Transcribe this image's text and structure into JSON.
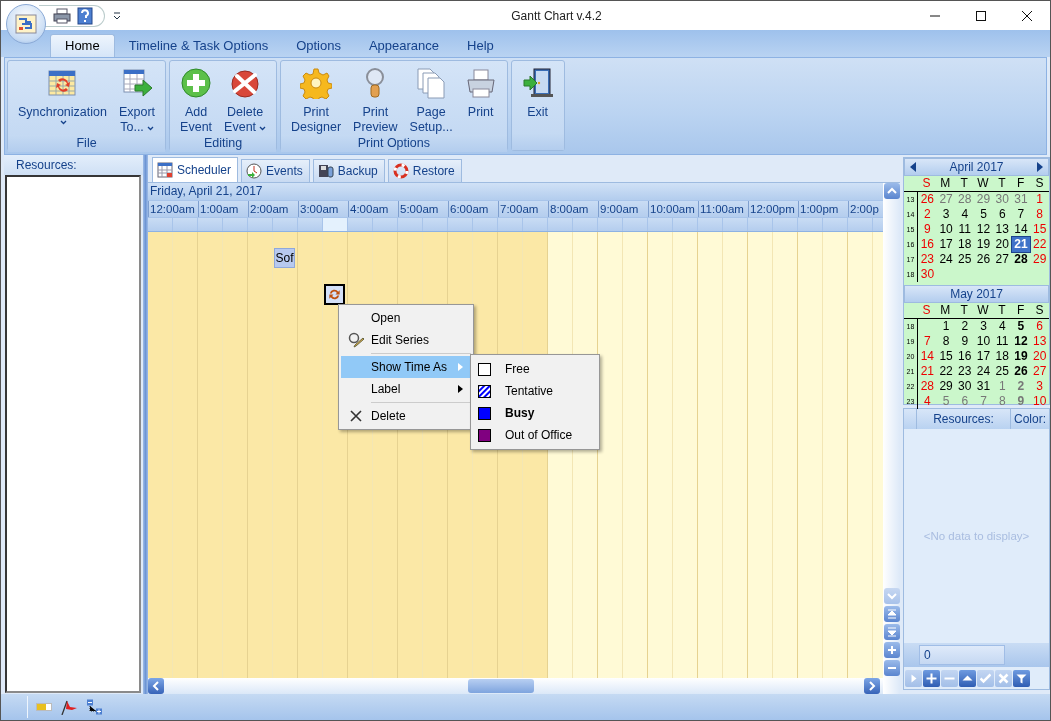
{
  "window": {
    "title": "Gantt Chart v.4.2"
  },
  "ribbon_tabs": [
    {
      "label": "Home",
      "selected": true
    },
    {
      "label": "Timeline & Task Options",
      "selected": false
    },
    {
      "label": "Options",
      "selected": false
    },
    {
      "label": "Appearance",
      "selected": false
    },
    {
      "label": "Help",
      "selected": false
    }
  ],
  "ribbon_groups": [
    {
      "label": "File",
      "buttons": [
        {
          "lines": [
            "Synchronization"
          ],
          "dropdown": true
        },
        {
          "lines": [
            "Export",
            "To..."
          ],
          "dropdown": true
        }
      ]
    },
    {
      "label": "Editing",
      "buttons": [
        {
          "lines": [
            "Add",
            "Event"
          ],
          "dropdown": false
        },
        {
          "lines": [
            "Delete",
            "Event"
          ],
          "dropdown": true
        }
      ]
    },
    {
      "label": "Print Options",
      "buttons": [
        {
          "lines": [
            "Print",
            "Designer"
          ],
          "dropdown": false
        },
        {
          "lines": [
            "Print",
            "Preview"
          ],
          "dropdown": false
        },
        {
          "lines": [
            "Page",
            "Setup..."
          ],
          "dropdown": false
        },
        {
          "lines": [
            "Print"
          ],
          "dropdown": false
        }
      ]
    },
    {
      "buttons": [
        {
          "lines": [
            "Exit"
          ],
          "dropdown": false
        }
      ]
    }
  ],
  "left_panel": {
    "header": "Resources:"
  },
  "view_tabs": [
    {
      "label": "Scheduler",
      "selected": true
    },
    {
      "label": "Events",
      "selected": false
    },
    {
      "label": "Backup",
      "selected": false
    },
    {
      "label": "Restore",
      "selected": false
    }
  ],
  "scheduler": {
    "date": "Friday, April 21, 2017",
    "time_slots": [
      {
        "label": "12:00am",
        "work": false,
        "marked": false
      },
      {
        "label": "1:00am",
        "work": false,
        "marked": false
      },
      {
        "label": "2:00am",
        "work": false,
        "marked": false
      },
      {
        "label": "3:00am",
        "work": false,
        "marked": true
      },
      {
        "label": "4:00am",
        "work": false,
        "marked": false
      },
      {
        "label": "5:00am",
        "work": false,
        "marked": false
      },
      {
        "label": "6:00am",
        "work": false,
        "marked": false
      },
      {
        "label": "7:00am",
        "work": false,
        "marked": false
      },
      {
        "label": "8:00am",
        "work": true,
        "marked": false
      },
      {
        "label": "9:00am",
        "work": true,
        "marked": false
      },
      {
        "label": "10:00am",
        "work": true,
        "marked": false
      },
      {
        "label": "11:00am",
        "work": true,
        "marked": false
      },
      {
        "label": "12:00pm",
        "work": true,
        "marked": false
      },
      {
        "label": "1:00pm",
        "work": true,
        "marked": false
      },
      {
        "label": "2:00p",
        "work": true,
        "marked": false
      }
    ],
    "appointments": [
      {
        "label": "Sof",
        "selected": false,
        "recurring": false
      },
      {
        "selected": true,
        "recurring": true
      }
    ]
  },
  "context_menu": [
    {
      "kind": "item",
      "label": "Open",
      "selected": false
    },
    {
      "kind": "item",
      "label": "Edit Series",
      "selected": false
    },
    {
      "kind": "separator"
    },
    {
      "kind": "submenu",
      "label": "Show Time As",
      "selected": true
    },
    {
      "kind": "submenu",
      "label": "Label",
      "selected": false
    },
    {
      "kind": "separator"
    },
    {
      "kind": "item",
      "label": "Delete",
      "selected": false
    }
  ],
  "submenu": [
    {
      "label": "Free",
      "color": "#ffffff",
      "kind": "solid",
      "selected": false
    },
    {
      "label": "Tentative",
      "color": "#0000ff",
      "kind": "hatched",
      "selected": false
    },
    {
      "label": "Busy",
      "color": "#0000ff",
      "kind": "solid",
      "selected": true
    },
    {
      "label": "Out of Office",
      "color": "#800080",
      "kind": "solid",
      "selected": false
    }
  ],
  "calendars": [
    {
      "title": "April 2017",
      "prev": true,
      "next": true,
      "weekdays": [
        "S",
        "M",
        "T",
        "W",
        "T",
        "F",
        "S"
      ],
      "weeks": [
        {
          "number": "13",
          "skip_first": false,
          "days": [
            {
              "d": "26",
              "muted": false,
              "bold": false,
              "selected": false
            },
            {
              "d": "27",
              "muted": true,
              "bold": false,
              "selected": false
            },
            {
              "d": "28",
              "muted": true,
              "bold": false,
              "selected": false
            },
            {
              "d": "29",
              "muted": true,
              "bold": false,
              "selected": false
            },
            {
              "d": "30",
              "muted": true,
              "bold": false,
              "selected": false
            },
            {
              "d": "31",
              "muted": true,
              "bold": false,
              "selected": false
            },
            {
              "d": "1",
              "muted": false,
              "bold": false,
              "selected": false
            }
          ]
        },
        {
          "number": "14",
          "skip_first": false,
          "days": [
            {
              "d": "2",
              "muted": false,
              "bold": false,
              "selected": false
            },
            {
              "d": "3",
              "muted": false,
              "bold": false,
              "selected": false
            },
            {
              "d": "4",
              "muted": false,
              "bold": false,
              "selected": false
            },
            {
              "d": "5",
              "muted": false,
              "bold": false,
              "selected": false
            },
            {
              "d": "6",
              "muted": false,
              "bold": false,
              "selected": false
            },
            {
              "d": "7",
              "muted": false,
              "bold": false,
              "selected": false
            },
            {
              "d": "8",
              "muted": false,
              "bold": false,
              "selected": false
            }
          ]
        },
        {
          "number": "15",
          "skip_first": false,
          "days": [
            {
              "d": "9",
              "muted": false,
              "bold": false,
              "selected": false
            },
            {
              "d": "10",
              "muted": false,
              "bold": false,
              "selected": false
            },
            {
              "d": "11",
              "muted": false,
              "bold": false,
              "selected": false
            },
            {
              "d": "12",
              "muted": false,
              "bold": false,
              "selected": false
            },
            {
              "d": "13",
              "muted": false,
              "bold": false,
              "selected": false
            },
            {
              "d": "14",
              "muted": false,
              "bold": false,
              "selected": false
            },
            {
              "d": "15",
              "muted": false,
              "bold": false,
              "selected": false
            }
          ]
        },
        {
          "number": "16",
          "skip_first": false,
          "days": [
            {
              "d": "16",
              "muted": false,
              "bold": false,
              "selected": false
            },
            {
              "d": "17",
              "muted": false,
              "bold": false,
              "selected": false
            },
            {
              "d": "18",
              "muted": false,
              "bold": false,
              "selected": false
            },
            {
              "d": "19",
              "muted": false,
              "bold": false,
              "selected": false
            },
            {
              "d": "20",
              "muted": false,
              "bold": false,
              "selected": false
            },
            {
              "d": "21",
              "muted": false,
              "bold": true,
              "selected": true
            },
            {
              "d": "22",
              "muted": false,
              "bold": false,
              "selected": false
            }
          ]
        },
        {
          "number": "17",
          "skip_first": false,
          "days": [
            {
              "d": "23",
              "muted": false,
              "bold": false,
              "selected": false
            },
            {
              "d": "24",
              "muted": false,
              "bold": false,
              "selected": false
            },
            {
              "d": "25",
              "muted": false,
              "bold": false,
              "selected": false
            },
            {
              "d": "26",
              "muted": false,
              "bold": false,
              "selected": false
            },
            {
              "d": "27",
              "muted": false,
              "bold": false,
              "selected": false
            },
            {
              "d": "28",
              "muted": false,
              "bold": true,
              "selected": false
            },
            {
              "d": "29",
              "muted": false,
              "bold": false,
              "selected": false
            }
          ]
        },
        {
          "number": "18",
          "skip_first": false,
          "days": [
            {
              "d": "30",
              "muted": false,
              "bold": false,
              "selected": false
            }
          ]
        }
      ]
    },
    {
      "title": "May 2017",
      "prev": false,
      "next": false,
      "weekdays": [
        "S",
        "M",
        "T",
        "W",
        "T",
        "F",
        "S"
      ],
      "weeks": [
        {
          "number": "18",
          "skip_first": true,
          "days": [
            {
              "d": "1",
              "muted": false,
              "bold": false,
              "selected": false
            },
            {
              "d": "2",
              "muted": false,
              "bold": false,
              "selected": false
            },
            {
              "d": "3",
              "muted": false,
              "bold": false,
              "selected": false
            },
            {
              "d": "4",
              "muted": false,
              "bold": false,
              "selected": false
            },
            {
              "d": "5",
              "muted": false,
              "bold": true,
              "selected": false
            },
            {
              "d": "6",
              "muted": false,
              "bold": false,
              "selected": false
            }
          ]
        },
        {
          "number": "19",
          "skip_first": false,
          "days": [
            {
              "d": "7",
              "muted": false,
              "bold": false,
              "selected": false
            },
            {
              "d": "8",
              "muted": false,
              "bold": false,
              "selected": false
            },
            {
              "d": "9",
              "muted": false,
              "bold": false,
              "selected": false
            },
            {
              "d": "10",
              "muted": false,
              "bold": false,
              "selected": false
            },
            {
              "d": "11",
              "muted": false,
              "bold": false,
              "selected": false
            },
            {
              "d": "12",
              "muted": false,
              "bold": true,
              "selected": false
            },
            {
              "d": "13",
              "muted": false,
              "bold": false,
              "selected": false
            }
          ]
        },
        {
          "number": "20",
          "skip_first": false,
          "days": [
            {
              "d": "14",
              "muted": false,
              "bold": false,
              "selected": false
            },
            {
              "d": "15",
              "muted": false,
              "bold": false,
              "selected": false
            },
            {
              "d": "16",
              "muted": false,
              "bold": false,
              "selected": false
            },
            {
              "d": "17",
              "muted": false,
              "bold": false,
              "selected": false
            },
            {
              "d": "18",
              "muted": false,
              "bold": false,
              "selected": false
            },
            {
              "d": "19",
              "muted": false,
              "bold": true,
              "selected": false
            },
            {
              "d": "20",
              "muted": false,
              "bold": false,
              "selected": false
            }
          ]
        },
        {
          "number": "21",
          "skip_first": false,
          "days": [
            {
              "d": "21",
              "muted": false,
              "bold": false,
              "selected": false
            },
            {
              "d": "22",
              "muted": false,
              "bold": false,
              "selected": false
            },
            {
              "d": "23",
              "muted": false,
              "bold": false,
              "selected": false
            },
            {
              "d": "24",
              "muted": false,
              "bold": false,
              "selected": false
            },
            {
              "d": "25",
              "muted": false,
              "bold": false,
              "selected": false
            },
            {
              "d": "26",
              "muted": false,
              "bold": true,
              "selected": false
            },
            {
              "d": "27",
              "muted": false,
              "bold": false,
              "selected": false
            }
          ]
        },
        {
          "number": "22",
          "skip_first": false,
          "days": [
            {
              "d": "28",
              "muted": false,
              "bold": false,
              "selected": false
            },
            {
              "d": "29",
              "muted": false,
              "bold": false,
              "selected": false
            },
            {
              "d": "30",
              "muted": false,
              "bold": false,
              "selected": false
            },
            {
              "d": "31",
              "muted": false,
              "bold": false,
              "selected": false
            },
            {
              "d": "1",
              "muted": true,
              "bold": false,
              "selected": false
            },
            {
              "d": "2",
              "muted": true,
              "bold": true,
              "selected": false
            },
            {
              "d": "3",
              "muted": false,
              "bold": false,
              "selected": false
            }
          ]
        },
        {
          "number": "23",
          "skip_first": false,
          "days": [
            {
              "d": "4",
              "muted": false,
              "bold": false,
              "selected": false
            },
            {
              "d": "5",
              "muted": true,
              "bold": false,
              "selected": false
            },
            {
              "d": "6",
              "muted": true,
              "bold": false,
              "selected": false
            },
            {
              "d": "7",
              "muted": true,
              "bold": false,
              "selected": false
            },
            {
              "d": "8",
              "muted": true,
              "bold": false,
              "selected": false
            },
            {
              "d": "9",
              "muted": true,
              "bold": true,
              "selected": false
            },
            {
              "d": "10",
              "muted": false,
              "bold": false,
              "selected": false
            }
          ]
        }
      ]
    }
  ],
  "resource_grid": {
    "columns": [
      "Resources:",
      "Color:"
    ],
    "empty_text": "<No data to display>",
    "footer_value": "0",
    "navigator": [
      {
        "disabled": true
      },
      {
        "disabled": false
      },
      {
        "disabled": true
      },
      {
        "disabled": false
      },
      {
        "disabled": true
      },
      {
        "disabled": true
      },
      {
        "disabled": false
      }
    ]
  }
}
